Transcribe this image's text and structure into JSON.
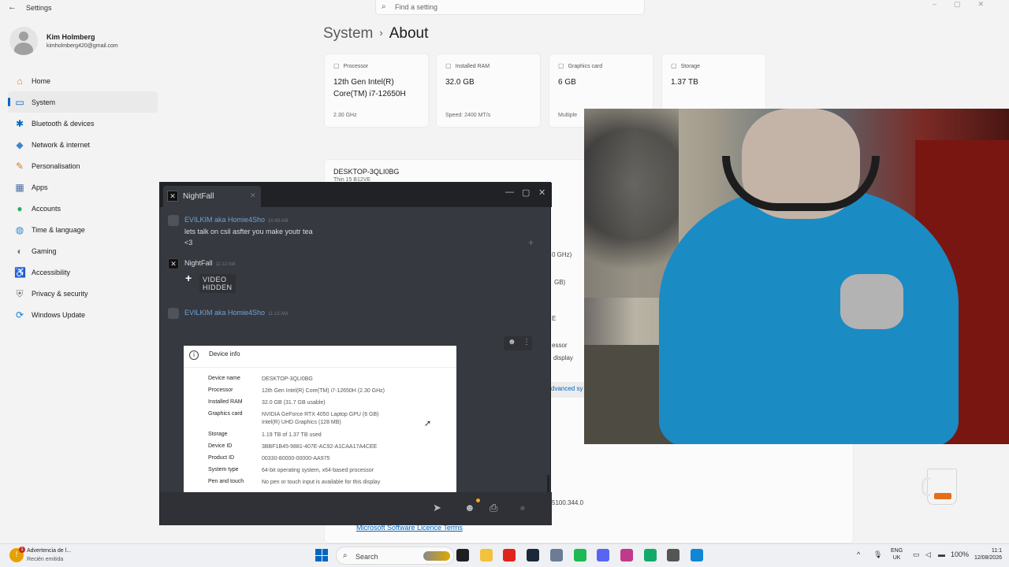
{
  "settings": {
    "app_title": "Settings",
    "search_placeholder": "Find a setting",
    "user": {
      "name": "Kim Holmberg",
      "email": "kimholmberg420@gmail.com"
    },
    "nav": [
      {
        "label": "Home",
        "icon": "home-icon",
        "glyph": "⌂",
        "color": "#d08040"
      },
      {
        "label": "System",
        "icon": "system-icon",
        "glyph": "▭",
        "color": "#0067c0",
        "active": true
      },
      {
        "label": "Bluetooth & devices",
        "icon": "bluetooth-icon",
        "glyph": "✱",
        "color": "#0067c0"
      },
      {
        "label": "Network & internet",
        "icon": "network-icon",
        "glyph": "◆",
        "color": "#3a86d4"
      },
      {
        "label": "Personalisation",
        "icon": "brush-icon",
        "glyph": "✎",
        "color": "#d37a2c"
      },
      {
        "label": "Apps",
        "icon": "apps-icon",
        "glyph": "▦",
        "color": "#4a6fa5"
      },
      {
        "label": "Accounts",
        "icon": "accounts-icon",
        "glyph": "●",
        "color": "#2faa6c"
      },
      {
        "label": "Time & language",
        "icon": "globe-icon",
        "glyph": "◍",
        "color": "#2a8ad4"
      },
      {
        "label": "Gaming",
        "icon": "gamepad-icon",
        "glyph": "◐",
        "color": "#777777"
      },
      {
        "label": "Accessibility",
        "icon": "accessibility-icon",
        "glyph": "♿",
        "color": "#1b6ac9"
      },
      {
        "label": "Privacy & security",
        "icon": "shield-icon",
        "glyph": "⛨",
        "color": "#777777"
      },
      {
        "label": "Windows Update",
        "icon": "update-icon",
        "glyph": "⟳",
        "color": "#0a7fd6"
      }
    ],
    "breadcrumb": {
      "parent": "System",
      "separator": "›",
      "current": "About"
    },
    "spec_cards": [
      {
        "label": "Processor",
        "value": "12th Gen Intel(R) Core(TM) i7-12650H",
        "sub": "2.30 GHz"
      },
      {
        "label": "Installed RAM",
        "value": "32.0 GB",
        "sub": "Speed: 2400 MT/s"
      },
      {
        "label": "Graphics card",
        "value": "6 GB",
        "sub": "Multiple"
      },
      {
        "label": "Storage",
        "value": "1.37 TB",
        "sub": ""
      }
    ],
    "device_name": "DESKTOP-3QLI0BG",
    "device_model": "Thin 15 B12VE",
    "peek_texts": [
      "0 GHz)",
      "GB)",
      "E",
      "essor",
      "display"
    ],
    "advanced_link": "dvanced sy",
    "version": "5100.344.0",
    "licence_link": "Microsoft Software Licence Terms"
  },
  "chat": {
    "tab_title": "NightFall",
    "tab_avatar_glyph": "✕",
    "messages": [
      {
        "author": "EVILKIM aka Homie4Sho",
        "time": "10:48 AM",
        "lines": [
          "lets talk on csil asfter you make youtr tea",
          "<3"
        ]
      },
      {
        "author": "NightFall",
        "time": "11:12 AM",
        "video_label": "VIDEO HIDDEN"
      },
      {
        "author": "EVILKIM aka Homie4Sho",
        "time": "11:13 AM"
      }
    ],
    "embed": {
      "title": "Device info",
      "rows": [
        {
          "key": "Device name",
          "value": "DESKTOP-3QLI0BG"
        },
        {
          "key": "Processor",
          "value": "12th Gen Intel(R) Core(TM) i7-12650H (2.30 GHz)"
        },
        {
          "key": "Installed RAM",
          "value": "32.0 GB (31.7 GB usable)"
        },
        {
          "key": "Graphics card",
          "value": "NVIDIA GeForce RTX 4050 Laptop GPU (6 GB)",
          "value2": "Intel(R) UHD Graphics (128 MB)"
        },
        {
          "key": "Storage",
          "value": "1.19 TB of 1.37 TB used"
        },
        {
          "key": "Device ID",
          "value": "3BBF1B45-9881-407E-AC92-A1CAA17A4CEE"
        },
        {
          "key": "Product ID",
          "value": "00330-80000-00000-AA975"
        },
        {
          "key": "System type",
          "value": "64-bit operating system, x64-based processor"
        },
        {
          "key": "Pen and touch",
          "value": "No pen or touch input is available for this display"
        }
      ]
    }
  },
  "taskbar": {
    "notification": {
      "title": "Advertencia de l...",
      "subtitle": "Recién emitida",
      "badge": "1"
    },
    "search_label": "Search",
    "apps": [
      {
        "name": "file-explorer-icon",
        "color": "#1f1f1f"
      },
      {
        "name": "folder-icon",
        "color": "#f3c23c"
      },
      {
        "name": "opera-icon",
        "color": "#e0241c"
      },
      {
        "name": "steam-icon",
        "color": "#1b2838"
      },
      {
        "name": "settings-gear-icon",
        "color": "#6b7c93"
      },
      {
        "name": "spotify-icon",
        "color": "#1db954"
      },
      {
        "name": "discord-icon",
        "color": "#5865f2"
      },
      {
        "name": "snipping-tool-icon",
        "color": "#c0398a"
      },
      {
        "name": "green-app-icon",
        "color": "#13a96b"
      },
      {
        "name": "alien-app-icon",
        "color": "#555555"
      },
      {
        "name": "edge-icon",
        "color": "#0f87d6"
      }
    ],
    "tray": {
      "chevron": "^",
      "battery": "100%"
    },
    "language": {
      "line1": "ENG",
      "line2": "UK"
    },
    "clock": {
      "time": "11:1",
      "date": "12/08/2026"
    }
  }
}
